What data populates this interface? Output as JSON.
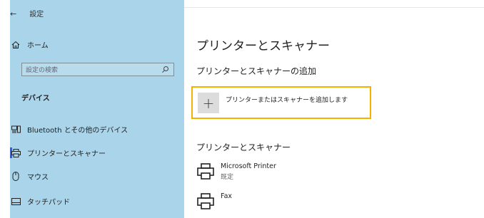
{
  "window": {
    "back_label": "設定"
  },
  "sidebar": {
    "home_label": "ホーム",
    "search_placeholder": "設定の検索",
    "section_label": "デバイス",
    "items": [
      {
        "label": "Bluetooth とその他のデバイス",
        "icon": "bluetooth-devices-icon"
      },
      {
        "label": "プリンターとスキャナー",
        "icon": "printer-icon",
        "active": true
      },
      {
        "label": "マウス",
        "icon": "mouse-icon"
      },
      {
        "label": "タッチパッド",
        "icon": "touchpad-icon"
      }
    ]
  },
  "main": {
    "title": "プリンターとスキャナー",
    "add_section_title": "プリンターとスキャナーの追加",
    "add_button_label": "プリンターまたはスキャナーを追加します",
    "list_title": "プリンターとスキャナー",
    "printers": [
      {
        "name": "Microsoft Printer",
        "status": "既定"
      },
      {
        "name": "Fax",
        "status": ""
      }
    ]
  },
  "colors": {
    "sidebar_bg": "#a9d4ea",
    "highlight_border": "#f2b200",
    "active_indicator": "#3a5fcb"
  }
}
